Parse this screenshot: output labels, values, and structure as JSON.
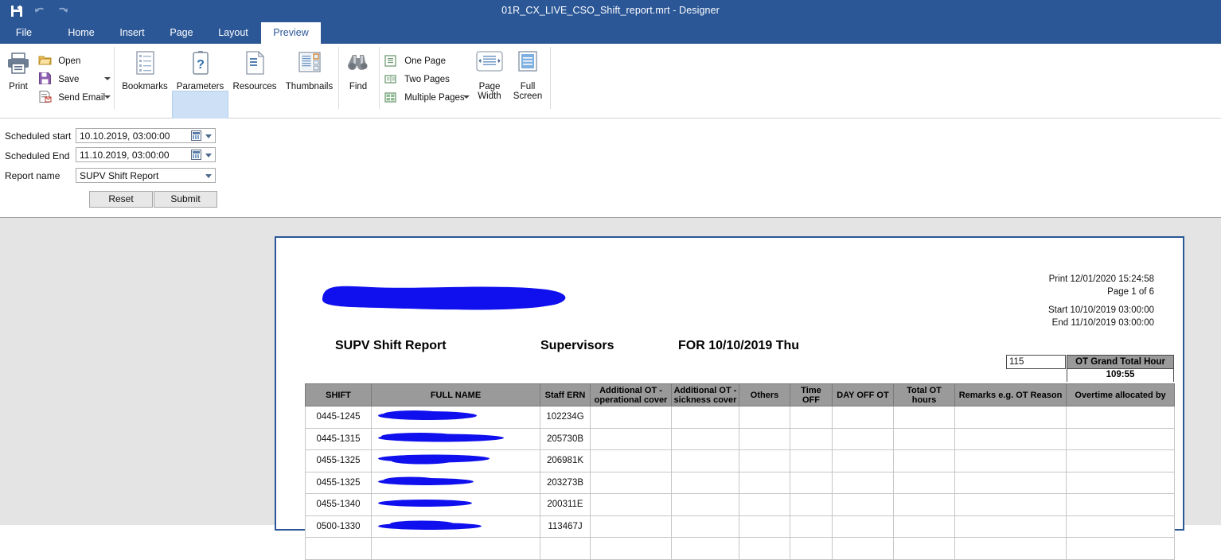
{
  "window": {
    "title": "01R_CX_LIVE_CSO_Shift_report.mrt - Designer",
    "quick_access": [
      {
        "name": "save-icon",
        "label": "Save"
      },
      {
        "name": "undo-icon",
        "label": "Undo"
      },
      {
        "name": "redo-icon",
        "label": "Redo"
      }
    ]
  },
  "tabs": [
    {
      "label": "File",
      "active": false
    },
    {
      "label": "Home",
      "active": false
    },
    {
      "label": "Insert",
      "active": false
    },
    {
      "label": "Page",
      "active": false
    },
    {
      "label": "Layout",
      "active": false
    },
    {
      "label": "Preview",
      "active": true
    }
  ],
  "ribbon": {
    "groups": [
      {
        "name": "file",
        "label": "File"
      },
      {
        "name": "panels",
        "label": "Panels"
      },
      {
        "name": "tools",
        "label": "Tools"
      },
      {
        "name": "view",
        "label": "View"
      }
    ],
    "file": {
      "print": "Print",
      "open": "Open",
      "save": "Save",
      "send_email": "Send Email"
    },
    "panels": {
      "bookmarks": "Bookmarks",
      "parameters": "Parameters",
      "resources": "Resources",
      "thumbnails": "Thumbnails",
      "selected": "Parameters"
    },
    "tools": {
      "find": "Find"
    },
    "view": {
      "one_page": "One Page",
      "two_pages": "Two Pages",
      "multiple_pages": "Multiple Pages",
      "page_width_l1": "Page",
      "page_width_l2": "Width",
      "full_screen_l1": "Full",
      "full_screen_l2": "Screen"
    }
  },
  "parameters": {
    "scheduled_start": {
      "label": "Scheduled start",
      "value": "10.10.2019, 03:00:00"
    },
    "scheduled_end": {
      "label": "Scheduled End",
      "value": "11.10.2019, 03:00:00"
    },
    "report_name": {
      "label": "Report name",
      "value": "SUPV Shift Report"
    },
    "reset_button": "Reset",
    "submit_button": "Submit"
  },
  "report": {
    "print_line": "Print 12/01/2020 15:24:58",
    "page_line": "Page 1 of 6",
    "start_line": "Start 10/10/2019 03:00:00",
    "end_line": "End 11/10/2019 03:00:00",
    "title": "SUPV Shift Report",
    "subtitle": "Supervisors",
    "for_date": "FOR 10/10/2019 Thu",
    "count_box": "115",
    "grand_total_header": "OT Grand Total Hour",
    "grand_total_value": "109:55",
    "columns": [
      "SHIFT",
      "FULL NAME",
      "Staff ERN",
      "Additional OT - operational cover",
      "Additional OT - sickness cover",
      "Others",
      "Time OFF",
      "DAY OFF OT",
      "Total OT hours",
      "Remarks e.g. OT Reason",
      "Overtime allocated by"
    ],
    "rows": [
      {
        "shift": "0445-1245",
        "full_name": "",
        "staff_ern": "102234G",
        "ot_operational": "",
        "ot_sickness": "",
        "others": "",
        "time_off": "",
        "day_off_ot": "",
        "total_ot": "",
        "remarks": "",
        "allocated_by": ""
      },
      {
        "shift": "0445-1315",
        "full_name": "",
        "staff_ern": "205730B",
        "ot_operational": "",
        "ot_sickness": "",
        "others": "",
        "time_off": "",
        "day_off_ot": "",
        "total_ot": "",
        "remarks": "",
        "allocated_by": ""
      },
      {
        "shift": "0455-1325",
        "full_name": "",
        "staff_ern": "206981K",
        "ot_operational": "",
        "ot_sickness": "",
        "others": "",
        "time_off": "",
        "day_off_ot": "",
        "total_ot": "",
        "remarks": "",
        "allocated_by": ""
      },
      {
        "shift": "0455-1325",
        "full_name": "",
        "staff_ern": "203273B",
        "ot_operational": "",
        "ot_sickness": "",
        "others": "",
        "time_off": "",
        "day_off_ot": "",
        "total_ot": "",
        "remarks": "",
        "allocated_by": ""
      },
      {
        "shift": "0455-1340",
        "full_name": "",
        "staff_ern": "200311E",
        "ot_operational": "",
        "ot_sickness": "",
        "others": "",
        "time_off": "",
        "day_off_ot": "",
        "total_ot": "",
        "remarks": "",
        "allocated_by": ""
      },
      {
        "shift": "0500-1330",
        "full_name": "",
        "staff_ern": "113467J",
        "ot_operational": "",
        "ot_sickness": "",
        "others": "",
        "time_off": "",
        "day_off_ot": "",
        "total_ot": "",
        "remarks": "",
        "allocated_by": ""
      },
      {
        "shift": "",
        "full_name": "",
        "staff_ern": "",
        "ot_operational": "",
        "ot_sickness": "",
        "others": "",
        "time_off": "",
        "day_off_ot": "",
        "total_ot": "",
        "remarks": "",
        "allocated_by": ""
      }
    ]
  },
  "colors": {
    "titlebar": "#2b5797",
    "ribbon_selection": "#cde0f6",
    "table_header": "#9a9a9a",
    "redaction": "#1010ee",
    "viewer_background": "#e4e4e4"
  }
}
